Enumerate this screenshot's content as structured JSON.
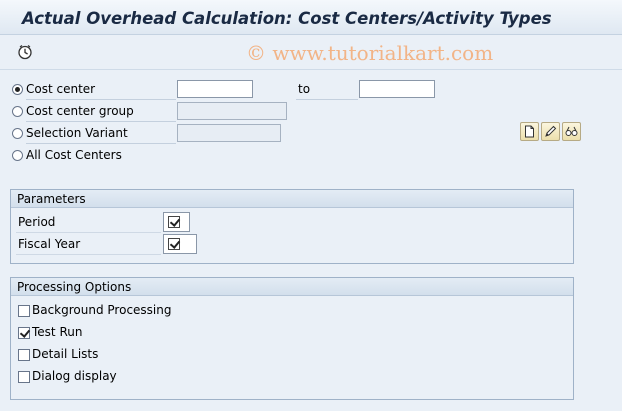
{
  "window": {
    "title": "Actual Overhead Calculation: Cost Centers/Activity Types"
  },
  "watermark": "© www.tutorialkart.com",
  "toolbar": {
    "execute_icon": "execute-clock-icon"
  },
  "selection": {
    "options": [
      {
        "label": "Cost center",
        "selected": true
      },
      {
        "label": "Cost center group",
        "selected": false
      },
      {
        "label": "Selection Variant",
        "selected": false
      },
      {
        "label": "All Cost Centers",
        "selected": false
      }
    ],
    "cost_center_from": "",
    "to_label": "to",
    "cost_center_to": "",
    "cost_center_group": "",
    "selection_variant": "",
    "variant_buttons": [
      "create-variant-icon",
      "change-variant-icon",
      "display-variant-icon"
    ]
  },
  "parameters": {
    "header": "Parameters",
    "period_label": "Period",
    "period_checked": true,
    "fiscal_year_label": "Fiscal Year",
    "fiscal_year_checked": true
  },
  "processing": {
    "header": "Processing Options",
    "options": [
      {
        "label": "Background Processing",
        "checked": false
      },
      {
        "label": "Test Run",
        "checked": true
      },
      {
        "label": "Detail Lists",
        "checked": false
      },
      {
        "label": "Dialog display",
        "checked": false
      }
    ]
  }
}
